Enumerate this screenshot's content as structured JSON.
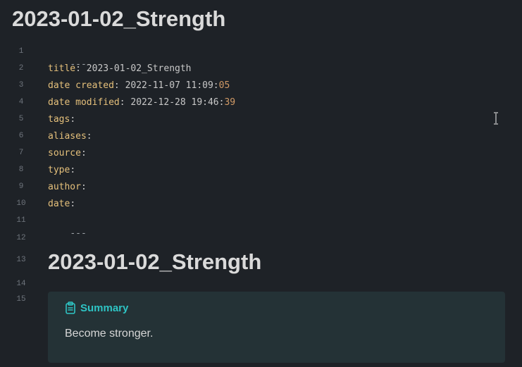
{
  "note": {
    "title": "2023-01-02_Strength"
  },
  "gutter": [
    "1",
    "2",
    "3",
    "4",
    "5",
    "6",
    "7",
    "8",
    "9",
    "10",
    "11",
    "12",
    "13",
    "14",
    "15"
  ],
  "frontmatter": {
    "open_delimiter": "---",
    "close_delimiter": "---",
    "lines": [
      {
        "key": "title",
        "colon": ":",
        "value": " 2023-01-02_Strength",
        "tail": ""
      },
      {
        "key": "date created",
        "colon": ":",
        "value": " 2022-11-07 11:09:",
        "tail": "05"
      },
      {
        "key": "date modified",
        "colon": ":",
        "value": " 2022-12-28 19:46:",
        "tail": "39"
      },
      {
        "key": "tags",
        "colon": ":",
        "value": "",
        "tail": ""
      },
      {
        "key": "aliases",
        "colon": ":",
        "value": "",
        "tail": ""
      },
      {
        "key": "source",
        "colon": ":",
        "value": "",
        "tail": ""
      },
      {
        "key": "type",
        "colon": ":",
        "value": "",
        "tail": ""
      },
      {
        "key": "author",
        "colon": ":",
        "value": "",
        "tail": ""
      },
      {
        "key": "date",
        "colon": ":",
        "value": "",
        "tail": ""
      }
    ]
  },
  "body": {
    "heading": "2023-01-02_Strength",
    "callout": {
      "icon": "clipboard-icon",
      "title": "Summary",
      "text": "Become stronger."
    }
  },
  "colors": {
    "background": "#1e2227",
    "yaml_key": "#e5c07b",
    "yaml_number": "#d19a66",
    "callout_accent": "#2ec4c4",
    "callout_background": "#243236"
  }
}
